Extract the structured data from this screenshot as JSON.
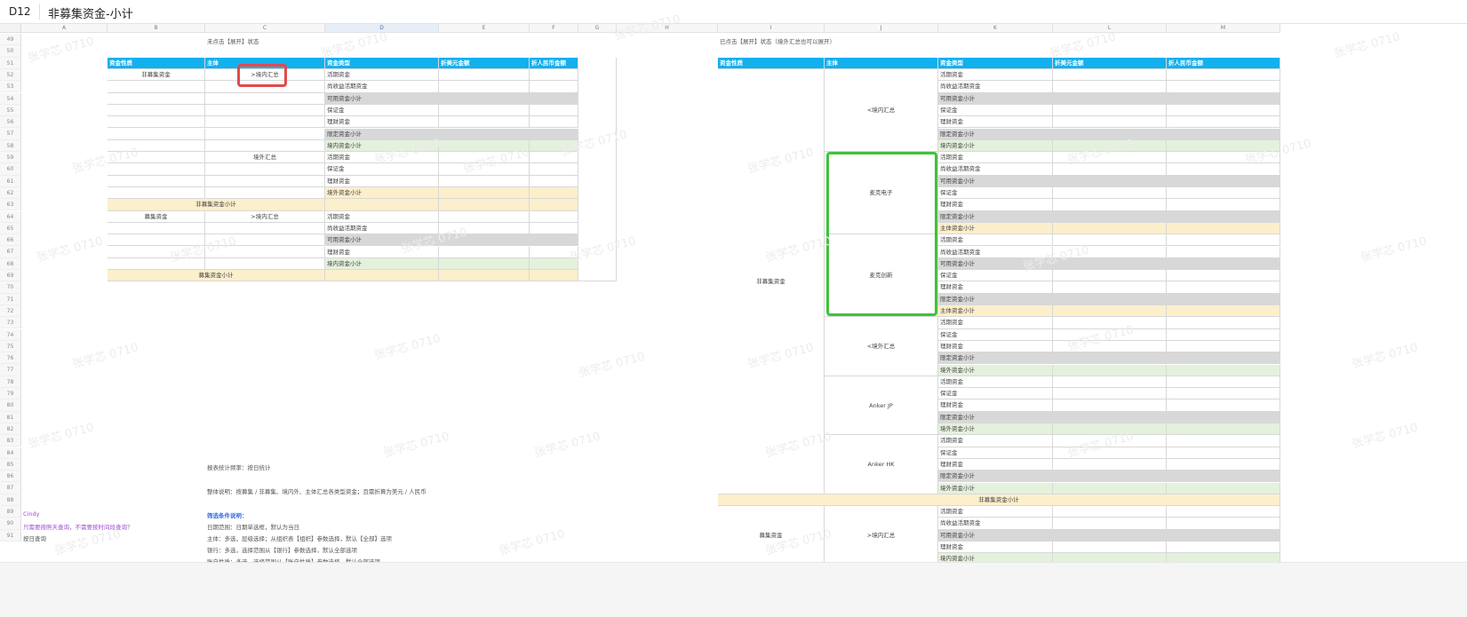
{
  "formula_bar": {
    "cell_ref": "D12",
    "value": "非募集资金-小计"
  },
  "columns": [
    "A",
    "B",
    "C",
    "D",
    "E",
    "F",
    "G",
    "H",
    "I",
    "J",
    "K",
    "L",
    "M"
  ],
  "rows": [
    "49",
    "50",
    "51",
    "52",
    "53",
    "54",
    "55",
    "56",
    "57",
    "58",
    "59",
    "60",
    "61",
    "62",
    "63",
    "64",
    "65",
    "66",
    "67",
    "68",
    "69",
    "70",
    "71",
    "72",
    "73",
    "74",
    "75",
    "76",
    "77",
    "78",
    "79",
    "80",
    "81",
    "82",
    "83",
    "84",
    "85",
    "86",
    "87",
    "88",
    "89",
    "90",
    "91"
  ],
  "left_table": {
    "title": "未点击【展开】状态",
    "headers": [
      "资金性质",
      "主体",
      "资金类型",
      "折美元金额",
      "折人民币金额"
    ],
    "rows": [
      {
        "nature": "非募集资金",
        "entity": ">境内汇总",
        "type": "活期资金",
        "style": ""
      },
      {
        "nature": "",
        "entity": "",
        "type": "尚收益活期资金",
        "style": ""
      },
      {
        "nature": "",
        "entity": "",
        "type": "可用资金小计",
        "style": "gray"
      },
      {
        "nature": "",
        "entity": "",
        "type": "保证金",
        "style": ""
      },
      {
        "nature": "",
        "entity": "",
        "type": "理财资金",
        "style": ""
      },
      {
        "nature": "",
        "entity": "",
        "type": "限定资金小计",
        "style": "gray"
      },
      {
        "nature": "",
        "entity": "",
        "type": "境内资金小计",
        "style": "green"
      },
      {
        "nature": "",
        "entity": "境外汇总",
        "type": "活期资金",
        "style": ""
      },
      {
        "nature": "",
        "entity": "",
        "type": "保证金",
        "style": ""
      },
      {
        "nature": "",
        "entity": "",
        "type": "理财资金",
        "style": ""
      },
      {
        "nature": "",
        "entity": "",
        "type": "境外资金小计",
        "style": "yellow"
      },
      {
        "nature": "",
        "entity": "",
        "type": "",
        "style": "subtotal",
        "label": "非募集资金小计"
      },
      {
        "nature": "募集资金",
        "entity": ">境内汇总",
        "type": "活期资金",
        "style": ""
      },
      {
        "nature": "",
        "entity": "",
        "type": "尚收益活期资金",
        "style": ""
      },
      {
        "nature": "",
        "entity": "",
        "type": "可用资金小计",
        "style": "gray"
      },
      {
        "nature": "",
        "entity": "",
        "type": "理财资金",
        "style": ""
      },
      {
        "nature": "",
        "entity": "",
        "type": "境内资金小计",
        "style": "green"
      },
      {
        "nature": "",
        "entity": "",
        "type": "",
        "style": "subtotal",
        "label": "募集资金小计"
      }
    ]
  },
  "right_table": {
    "title": "已点击【展开】状态（境外汇总也可以展开）",
    "headers": [
      "资金性质",
      "主体",
      "资金类型",
      "折美元金额",
      "折人民币金额"
    ],
    "nature_1": "非募集资金",
    "nature_2": "募集资金",
    "entities": [
      {
        "name": "<境内汇总",
        "start": 0,
        "span": 7
      },
      {
        "name": "麦克电子",
        "start": 7,
        "span": 7
      },
      {
        "name": "麦克创新",
        "start": 14,
        "span": 7
      },
      {
        "name": "<境外汇总",
        "start": 21,
        "span": 5
      },
      {
        "name": "Anker JP",
        "start": 26,
        "span": 5
      },
      {
        "name": "Anker HK",
        "start": 31,
        "span": 5
      },
      {
        "name": ">境内汇总",
        "start": 37,
        "span": 5
      }
    ],
    "types": [
      {
        "t": "活期资金",
        "s": ""
      },
      {
        "t": "尚收益活期资金",
        "s": ""
      },
      {
        "t": "可用资金小计",
        "s": "gray"
      },
      {
        "t": "保证金",
        "s": ""
      },
      {
        "t": "理财资金",
        "s": ""
      },
      {
        "t": "限定资金小计",
        "s": "gray"
      },
      {
        "t": "境内资金小计",
        "s": "green"
      },
      {
        "t": "活期资金",
        "s": ""
      },
      {
        "t": "尚收益活期资金",
        "s": ""
      },
      {
        "t": "可用资金小计",
        "s": "gray"
      },
      {
        "t": "保证金",
        "s": ""
      },
      {
        "t": "理财资金",
        "s": ""
      },
      {
        "t": "限定资金小计",
        "s": "gray"
      },
      {
        "t": "主体资金小计",
        "s": "yellow"
      },
      {
        "t": "活期资金",
        "s": ""
      },
      {
        "t": "尚收益活期资金",
        "s": ""
      },
      {
        "t": "可用资金小计",
        "s": "gray"
      },
      {
        "t": "保证金",
        "s": ""
      },
      {
        "t": "理财资金",
        "s": ""
      },
      {
        "t": "限定资金小计",
        "s": "gray"
      },
      {
        "t": "主体资金小计",
        "s": "yellow"
      },
      {
        "t": "活期资金",
        "s": ""
      },
      {
        "t": "保证金",
        "s": ""
      },
      {
        "t": "理财资金",
        "s": ""
      },
      {
        "t": "限定资金小计",
        "s": "gray"
      },
      {
        "t": "境外资金小计",
        "s": "green"
      },
      {
        "t": "活期资金",
        "s": ""
      },
      {
        "t": "保证金",
        "s": ""
      },
      {
        "t": "理财资金",
        "s": ""
      },
      {
        "t": "限定资金小计",
        "s": "gray"
      },
      {
        "t": "境外资金小计",
        "s": "green"
      },
      {
        "t": "活期资金",
        "s": ""
      },
      {
        "t": "保证金",
        "s": ""
      },
      {
        "t": "理财资金",
        "s": ""
      },
      {
        "t": "限定资金小计",
        "s": "gray"
      },
      {
        "t": "境外资金小计",
        "s": "green"
      },
      {
        "t": "",
        "s": "subtotal",
        "label": "非募集资金小计"
      },
      {
        "t": "活期资金",
        "s": ""
      },
      {
        "t": "尚收益活期资金",
        "s": ""
      },
      {
        "t": "可用资金小计",
        "s": "gray"
      },
      {
        "t": "理财资金",
        "s": ""
      },
      {
        "t": "境内资金小计",
        "s": "green"
      }
    ]
  },
  "notes": {
    "report_freq": "报表统计频率：按日统计",
    "overall": "整体说明：按募集 / 非募集、境内外、主体汇总各类型资金；且需折算为美元 / 人民币",
    "cindy": "Cindy",
    "question": "只需要按照天查询，不需要按时间段查询？",
    "by_date": "按日查询",
    "filter_title": "筛选条件说明：",
    "filter_1": "日期范围：日期单选框，默认为当日",
    "filter_2": "主体：多选，层级选择；从组织表【组织】参数选择，默认【全部】选项",
    "filter_3": "银行：多选，选择范围从【银行】参数选择，默认全部选项",
    "filter_4": "账户性质：多选，选择范围从【账户性质】参数选择，默认全部选项"
  },
  "watermark": "张学芯 0710"
}
